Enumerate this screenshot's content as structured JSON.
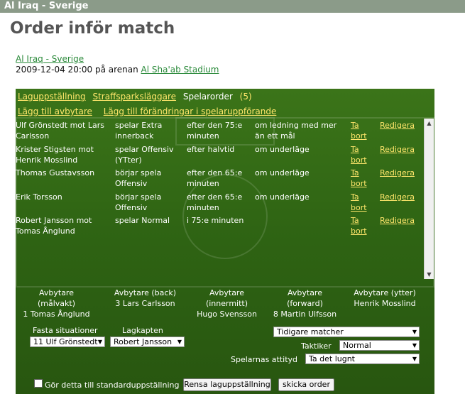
{
  "window": {
    "title": "Al Iraq - Sverige"
  },
  "page": {
    "title": "Order inför match"
  },
  "match": {
    "link": "Al Iraq - Sverige",
    "datetime_prefix": "2009-12-04 20:00 på arenan",
    "stadium": "Al Sha'ab Stadium"
  },
  "tabs": {
    "lineup": "Laguppställning",
    "penalty": "Straffsparksläggare",
    "player_orders": "Spelarorder",
    "player_orders_count": "(5)"
  },
  "actions": {
    "add_sub": "Lägg till avbytare",
    "add_behavior": "Lägg till förändringar i spelaruppförande"
  },
  "orders": [
    {
      "who": "Ulf Grönstedt mot Lars Carlsson",
      "what": "spelar Extra innerback",
      "when": "efter den 75:e minuten",
      "cond": "om ledning med mer än ett mål",
      "remove": "Ta bort",
      "edit": "Redigera"
    },
    {
      "who": "Krister Stigsten mot Henrik Mosslind",
      "what": "spelar Offensiv (YTter)",
      "when": "efter halvtid",
      "cond": "om underläge",
      "remove": "Ta bort",
      "edit": "Redigera"
    },
    {
      "who": "Thomas Gustavsson",
      "what": "börjar spela Offensiv",
      "when": "efter den 65:e minuten",
      "cond": "om underläge",
      "remove": "Ta bort",
      "edit": "Redigera"
    },
    {
      "who": "Erik Torsson",
      "what": "börjar spela Offensiv",
      "when": "efter den 65:e minuten",
      "cond": "om underläge",
      "remove": "Ta bort",
      "edit": "Redigera"
    },
    {
      "who": "Robert Jansson mot Tomas Ånglund",
      "what": "spelar Normal",
      "when": "i 75:e minuten",
      "cond": "",
      "remove": "Ta bort",
      "edit": "Redigera"
    }
  ],
  "substitutes": [
    {
      "role": "Avbytare (målvakt)",
      "player": "1 Tomas Ånglund"
    },
    {
      "role": "Avbytare (back)",
      "player": "3 Lars Carlsson"
    },
    {
      "role": "Avbytare (innermitt)",
      "player": "Hugo Svensson"
    },
    {
      "role": "Avbytare (forward)",
      "player": "8 Martin Ulfsson"
    },
    {
      "role": "Avbytare (ytter)",
      "player": "Henrik Mosslind"
    }
  ],
  "setpieces": {
    "label": "Fasta situationer",
    "value": "11 Ulf Grönstedt"
  },
  "captain": {
    "label": "Lagkapten",
    "value": "Robert Jansson"
  },
  "previous_matches": {
    "value": "Tidigare matcher"
  },
  "tactics": {
    "label": "Taktiker",
    "value": "Normal"
  },
  "attitude": {
    "label": "Spelarnas attityd",
    "value": "Ta det lugnt"
  },
  "bottom": {
    "checkbox_label": "Gör detta till standarduppställning",
    "clear_button": "Rensa laguppställning",
    "send_button": "skicka order"
  },
  "colors": {
    "title_bar": "#8b9b89",
    "pitch": "#2f5f14",
    "link_yellow": "#ffe66b",
    "link_green": "#2a8a3a"
  }
}
